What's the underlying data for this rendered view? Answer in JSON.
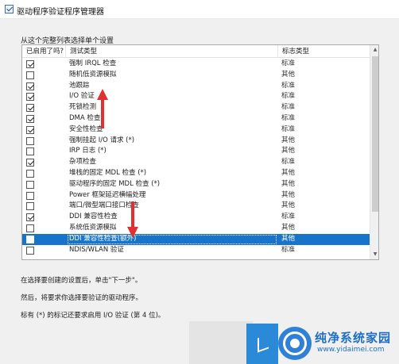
{
  "window": {
    "title": "驱动程序验证程序管理器",
    "title_checked": true
  },
  "group_label": "从这个完整列表选择单个设置",
  "list": {
    "columns": [
      "已启用了吗?",
      "测试类型",
      "标志类型"
    ],
    "rows": [
      {
        "enabled": true,
        "test": "强制 IRQL 检查",
        "type": "标准",
        "selected": false
      },
      {
        "enabled": false,
        "test": "随机低资源模拟",
        "type": "其他",
        "selected": false
      },
      {
        "enabled": true,
        "test": "池跟踪",
        "type": "标准",
        "selected": false
      },
      {
        "enabled": true,
        "test": "I/O 验证",
        "type": "标准",
        "selected": false
      },
      {
        "enabled": true,
        "test": "死锁检测",
        "type": "标准",
        "selected": false
      },
      {
        "enabled": true,
        "test": "DMA 检查",
        "type": "标准",
        "selected": false
      },
      {
        "enabled": true,
        "test": "安全性检查",
        "type": "标准",
        "selected": false
      },
      {
        "enabled": false,
        "test": "强制挂起 I/O 请求 (*)",
        "type": "其他",
        "selected": false
      },
      {
        "enabled": false,
        "test": "IRP 日志 (*)",
        "type": "其他",
        "selected": false
      },
      {
        "enabled": true,
        "test": "杂项检查",
        "type": "标准",
        "selected": false
      },
      {
        "enabled": false,
        "test": "堆栈的固定 MDL 检查 (*)",
        "type": "其他",
        "selected": false
      },
      {
        "enabled": false,
        "test": "驱动程序的固定 MDL 检查 (*)",
        "type": "其他",
        "selected": false
      },
      {
        "enabled": false,
        "test": "Power 框架延迟横幅处理",
        "type": "其他",
        "selected": false
      },
      {
        "enabled": false,
        "test": "端口/微型端口接口检查",
        "type": "其他",
        "selected": false
      },
      {
        "enabled": true,
        "test": "DDI 兼容性检查",
        "type": "标准",
        "selected": false
      },
      {
        "enabled": false,
        "test": "系统低资源模拟",
        "type": "其他",
        "selected": false
      },
      {
        "enabled": false,
        "test": "DDI 兼容性检查(额外)",
        "type": "其他",
        "selected": true
      },
      {
        "enabled": false,
        "test": "NDIS/WLAN 验证",
        "type": "标准",
        "selected": false
      }
    ]
  },
  "info_lines": [
    "在选择要创建的设置后，单击\"下一步\"。",
    "然后，将要求你选择要验证的驱动程序。",
    "标有 (*) 的标记还要求启用 I/O 验证 (第 4 位)。"
  ],
  "watermark": {
    "title": "纯净系统家园",
    "url": "www.yidaimei.com"
  },
  "colors": {
    "selection": "#1874c8",
    "annotation_arrow": "#e03030",
    "watermark": "#1f6fc6"
  },
  "icons": {
    "scroll_up": "▲",
    "scroll_down": "▼"
  }
}
